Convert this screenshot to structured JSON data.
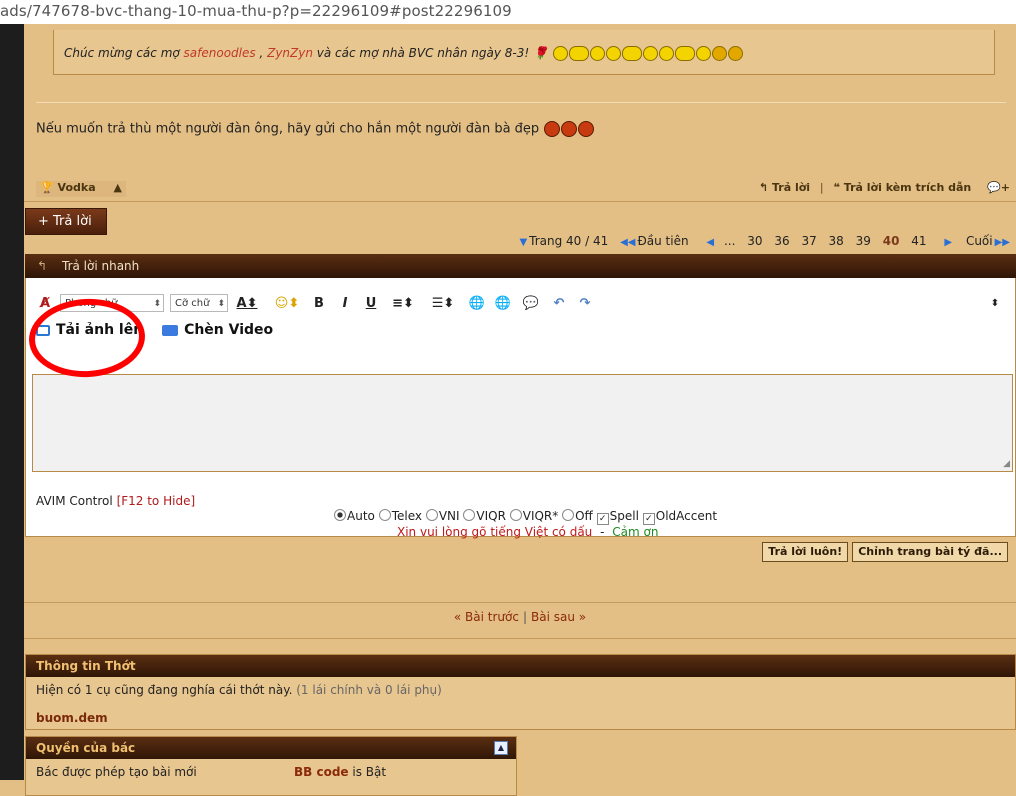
{
  "browser": {
    "url": "ads/747678-bvc-thang-10-mua-thu-p?p=22296109#post22296109"
  },
  "quote": {
    "prefix": "Chúc mừng các mợ ",
    "user1": "safenoodles",
    "comma": " , ",
    "user2": "ZynZyn",
    "suffix": " và các mợ nhà BVC nhân ngày 8-3!"
  },
  "post": {
    "message": "Nếu muốn trả thù một người đàn ông, hãy gửi cho hắn một người đàn bà đẹp",
    "author": "Vodka",
    "reply_label": "Trả lời",
    "reply_quote_label": "Trả lời kèm trích dẫn"
  },
  "reply_button": "+ Trả lời",
  "pager": {
    "label": "Trang 40 / 41",
    "first": "Đầu tiên",
    "ellipsis": "...",
    "pages": [
      "30",
      "36",
      "37",
      "38",
      "39",
      "40",
      "41"
    ],
    "current": "40",
    "last": "Cuối"
  },
  "quick_reply": {
    "title": "Trả lời nhanh",
    "font_select": "Phong chữ",
    "size_select": "Cỡ chữ",
    "upload_label": "Tải ảnh lên",
    "video_label": "Chèn Video",
    "avim_label": "AVIM Control",
    "avim_hide": "[F12 to Hide]",
    "modes": [
      "Auto",
      "Telex",
      "VNI",
      "VIQR",
      "VIQR*",
      "Off"
    ],
    "checks": [
      "Spell",
      "OldAccent"
    ],
    "hint_red": "Xin vui lòng gõ tiếng Việt có dấu",
    "hint_dash": "-",
    "hint_green": "Cảm ơn",
    "submit": "Trả lời luôn!",
    "advanced": "Chỉnh trang bài tý đã..."
  },
  "nav": {
    "prev": "« Bài trước",
    "sep": "|",
    "next": "Bài sau »"
  },
  "thread_info": {
    "title": "Thông tin Thớt",
    "text": "Hiện có 1 cụ cũng đang nghía cái thớt này.",
    "detail": "(1 lái chính và 0 lái phụ)",
    "user": "buom.dem"
  },
  "permissions": {
    "title": "Quyền của bác",
    "row": "Bác được phép tạo bài mới",
    "bbcode": "BB code",
    "bbcode_state": "is Bật"
  }
}
